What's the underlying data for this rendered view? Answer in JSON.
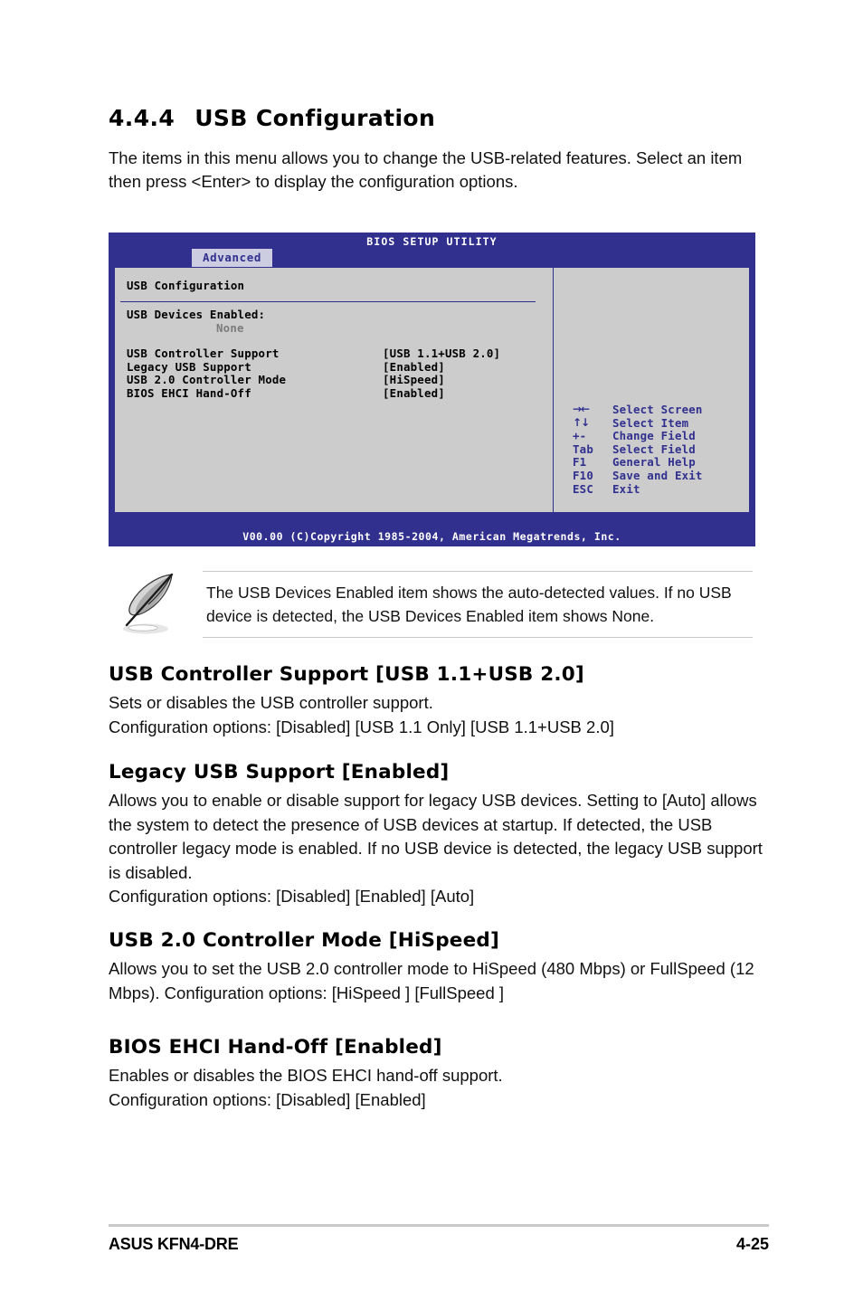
{
  "heading": {
    "number": "4.4.4",
    "title": "USB Configuration"
  },
  "intro": "The items in this menu allows you to change the USB-related features. Select an item then press <Enter> to display the configuration options.",
  "bios": {
    "title": "BIOS SETUP UTILITY",
    "tab": "Advanced",
    "panel_heading": "USB Configuration",
    "devices_label": "USB Devices Enabled:",
    "devices_value": "None",
    "items": [
      {
        "name": "USB Controller Support",
        "value": "[USB 1.1+USB 2.0]"
      },
      {
        "name": "Legacy USB Support",
        "value": "[Enabled]"
      },
      {
        "name": "USB 2.0 Controller Mode",
        "value": "[HiSpeed]"
      },
      {
        "name": "BIOS EHCI Hand-Off",
        "value": "[Enabled]"
      }
    ],
    "navkeys": [
      {
        "key": "→←",
        "desc": "Select Screen"
      },
      {
        "key": "↑↓",
        "desc": "Select Item"
      },
      {
        "key": "+-",
        "desc": "Change Field"
      },
      {
        "key": "Tab",
        "desc": "Select Field"
      },
      {
        "key": "F1",
        "desc": "General Help"
      },
      {
        "key": "F10",
        "desc": "Save and Exit"
      },
      {
        "key": "ESC",
        "desc": "Exit"
      }
    ],
    "footer": "V00.00 (C)Copyright 1985-2004, American Megatrends, Inc.",
    "colors": {
      "chrome_blue": "#31308f",
      "panel_gray": "#cccccc",
      "tab_bg": "#cccde0",
      "dim_text": "#7b7b7b"
    }
  },
  "note": {
    "icon": "quill-pen-icon",
    "text": "The USB Devices Enabled item shows the auto-detected values. If no USB device is detected, the USB Devices Enabled item shows None."
  },
  "sections": [
    {
      "title": "USB Controller Support [USB 1.1+USB 2.0]",
      "body": "Sets or disables the USB controller support.\nConfiguration options: [Disabled] [USB 1.1 Only] [USB 1.1+USB 2.0]"
    },
    {
      "title": "Legacy USB Support [Enabled]",
      "body": "Allows you to enable or disable support for legacy USB devices. Setting to [Auto] allows the system to detect the presence of USB devices at startup. If detected, the USB controller legacy mode is enabled. If no USB device is detected, the legacy USB support is disabled.\nConfiguration options: [Disabled] [Enabled] [Auto]"
    },
    {
      "title": "USB 2.0 Controller Mode [HiSpeed]",
      "body": "Allows you to set the USB 2.0 controller mode to HiSpeed (480 Mbps) or FullSpeed (12 Mbps). Configuration options: [HiSpeed ] [FullSpeed ]"
    },
    {
      "title": "BIOS EHCI Hand-Off [Enabled]",
      "body": "Enables or disables the BIOS EHCI hand-off support.\nConfiguration options: [Disabled] [Enabled]"
    }
  ],
  "page_footer": {
    "left": "ASUS KFN4-DRE",
    "right": "4-25"
  }
}
